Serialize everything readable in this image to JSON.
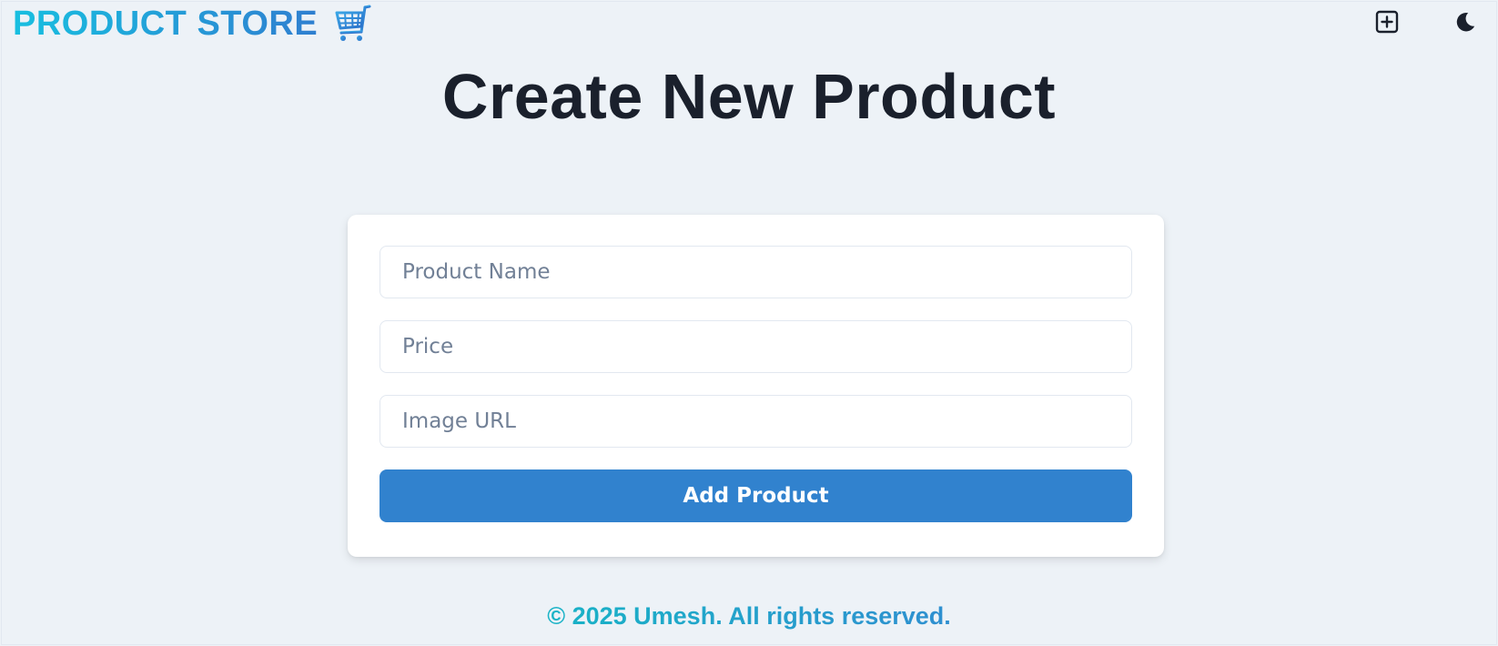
{
  "colors": {
    "background": "#edf2f7",
    "brand_gradient_start": "#18bfe0",
    "brand_gradient_end": "#2f7fd0",
    "title": "#1a202c",
    "card": "#ffffff",
    "primary_button": "#3182ce",
    "placeholder": "#718096"
  },
  "header": {
    "brand": "PRODUCT STORE",
    "brand_icon": "shopping-cart-icon",
    "actions": [
      {
        "icon": "plus-square-icon"
      },
      {
        "icon": "moon-icon"
      }
    ]
  },
  "page": {
    "title": "Create New Product"
  },
  "form": {
    "name_placeholder": "Product Name",
    "name_value": "",
    "price_placeholder": "Price",
    "price_value": "",
    "image_placeholder": "Image URL",
    "image_value": "",
    "submit_label": "Add Product"
  },
  "footer": {
    "text": "© 2025 Umesh. All rights reserved."
  }
}
